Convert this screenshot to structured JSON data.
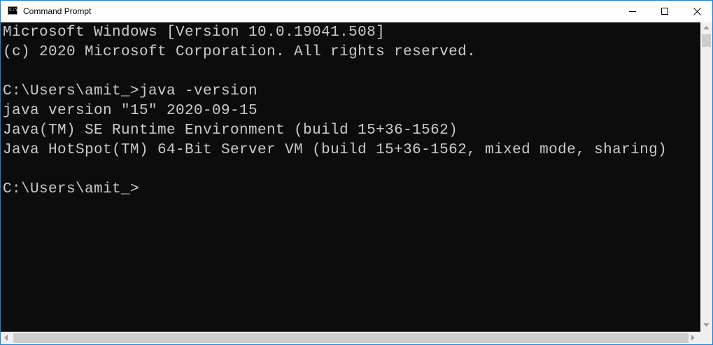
{
  "window": {
    "title": "Command Prompt",
    "icon": "console-app-icon",
    "icon_glyph": "C:\\"
  },
  "caption_buttons": {
    "minimize": "minimize-icon",
    "maximize": "maximize-icon",
    "close": "close-icon"
  },
  "console": {
    "lines": [
      "Microsoft Windows [Version 10.0.19041.508]",
      "(c) 2020 Microsoft Corporation. All rights reserved.",
      "",
      "C:\\Users\\amit_>java -version",
      "java version \"15\" 2020-09-15",
      "Java(TM) SE Runtime Environment (build 15+36-1562)",
      "Java HotSpot(TM) 64-Bit Server VM (build 15+36-1562, mixed mode, sharing)",
      "",
      "C:\\Users\\amit_>"
    ],
    "background_color": "#0c0c0c",
    "text_color": "#cccccc"
  },
  "scrollbars": {
    "vertical": "vertical-scrollbar",
    "horizontal": "horizontal-scrollbar"
  }
}
